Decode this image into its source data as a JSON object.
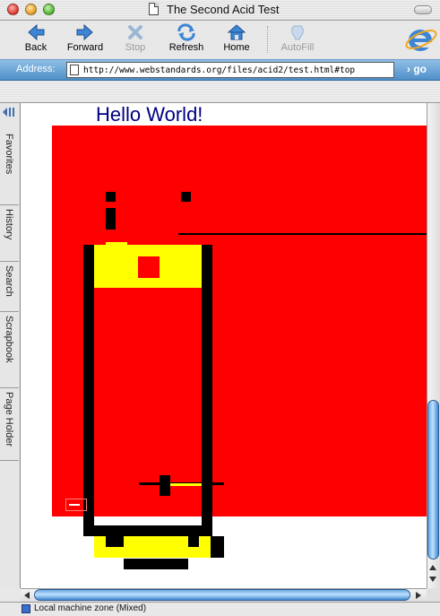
{
  "window": {
    "title": "The Second Acid Test"
  },
  "toolbar": {
    "buttons": [
      {
        "label": "Back",
        "icon": "back-arrow-icon",
        "enabled": true
      },
      {
        "label": "Forward",
        "icon": "forward-arrow-icon",
        "enabled": true
      },
      {
        "label": "Stop",
        "icon": "stop-x-icon",
        "enabled": false
      },
      {
        "label": "Refresh",
        "icon": "refresh-icon",
        "enabled": true
      },
      {
        "label": "Home",
        "icon": "home-icon",
        "enabled": true
      },
      {
        "label": "AutoFill",
        "icon": "autofill-icon",
        "enabled": false
      }
    ]
  },
  "address": {
    "label": "Address:",
    "url": "http://www.webstandards.org/files/acid2/test.html#top",
    "go_label": "go"
  },
  "explorer_tabs": [
    "Favorites",
    "History",
    "Search",
    "Scrapbook",
    "Page Holder"
  ],
  "content": {
    "heading": "Hello World!"
  },
  "status": {
    "zone": "Local machine zone (Mixed)"
  },
  "colors": {
    "render_red": "#ff0000",
    "render_yellow": "#ffff00",
    "heading_blue": "#000080",
    "addressbar_blue": "#4f8fc8"
  }
}
